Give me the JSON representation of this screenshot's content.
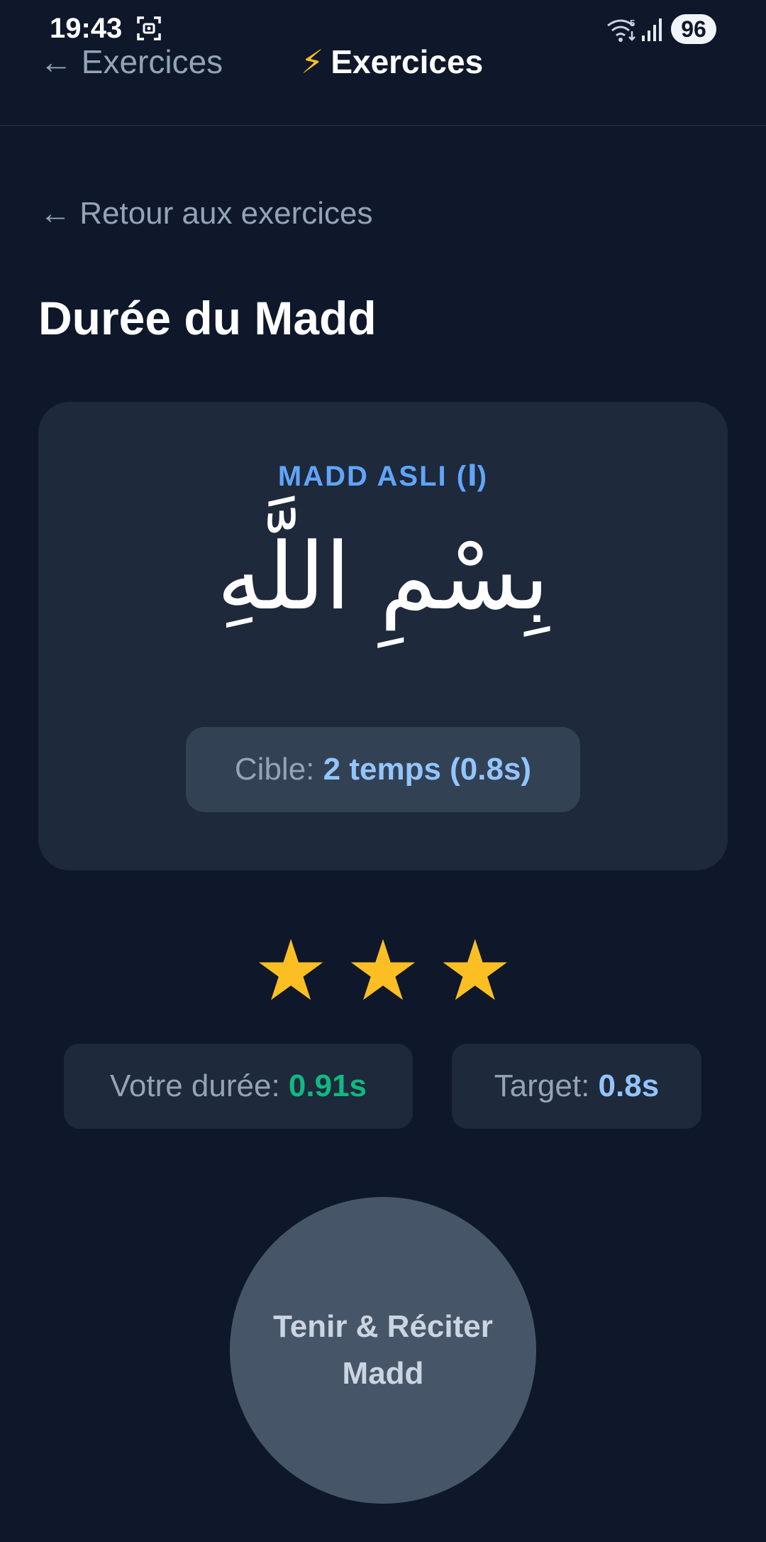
{
  "status_bar": {
    "time": "19:43",
    "battery": "96"
  },
  "header": {
    "back_label": "← Exercices",
    "title_icon": "⚡",
    "title": "Exercices"
  },
  "retour_link": "← Retour aux exercices",
  "page_title": "Durée du Madd",
  "card": {
    "label": "MADD ASLI (ا)",
    "arabic": "بِسْمِ اللَّهِ",
    "target_prefix": "Cible: ",
    "target_value": "2 temps (0.8s)"
  },
  "rating": {
    "stars": 3,
    "max": 3,
    "star_glyph": "★",
    "color": "#fbbf24"
  },
  "stats": {
    "duration_label": "Votre durée: ",
    "duration_value": "0.91s",
    "target_label": "Target: ",
    "target_value": "0.8s"
  },
  "record_button": {
    "line1": "Tenir & Réciter",
    "line2": "Madd"
  },
  "colors": {
    "background": "#0f172a",
    "card": "#1e293b",
    "accent_blue": "#60a5fa",
    "value_blue": "#93c5fd",
    "success_green": "#10b981",
    "star_gold": "#fbbf24"
  }
}
